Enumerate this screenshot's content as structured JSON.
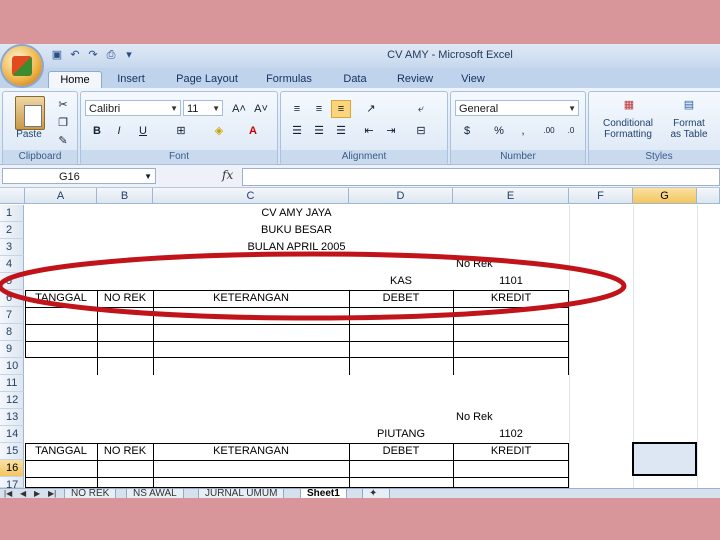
{
  "window": {
    "title": "CV AMY - Microsoft Excel"
  },
  "ribbon": {
    "tabs": [
      "Home",
      "Insert",
      "Page Layout",
      "Formulas",
      "Data",
      "Review",
      "View"
    ],
    "groups": [
      "Clipboard",
      "Font",
      "Alignment",
      "Number",
      "Styles"
    ],
    "paste_label": "Paste",
    "font_name": "Calibri",
    "font_size": "11",
    "number_format": "General",
    "conditional_formatting": [
      "Conditional",
      "Formatting"
    ],
    "format_as_table": [
      "Format",
      "as Table"
    ]
  },
  "formula_bar": {
    "name_box": "G16",
    "fx": "fx",
    "value": ""
  },
  "columns": [
    "A",
    "B",
    "C",
    "D",
    "E",
    "F",
    "G"
  ],
  "selected_column": "G",
  "rows": [
    "1",
    "2",
    "3",
    "4",
    "5",
    "6",
    "7",
    "8",
    "9",
    "10",
    "11",
    "12",
    "13",
    "14",
    "15",
    "16",
    "17"
  ],
  "selected_row": "16",
  "cells": {
    "C1": "CV AMY JAYA",
    "C2": "BUKU BESAR",
    "C3": "BULAN APRIL 2005",
    "E4": "No Rek",
    "D5": "KAS",
    "E5": "1101",
    "A6": "TANGGAL",
    "B6": "NO REK",
    "C6": "KETERANGAN",
    "D6": "DEBET",
    "E6": "KREDIT",
    "E13": "No Rek",
    "D14": "PIUTANG",
    "E14": "1102",
    "A15": "TANGGAL",
    "B15": "NO REK",
    "C15": "KETERANGAN",
    "D15": "DEBET",
    "E15": "KREDIT"
  },
  "sheet_tabs": [
    "NO REK",
    "NS AWAL",
    "JURNAL UMUM",
    "Sheet1"
  ],
  "active_sheet": "Sheet1",
  "annotation": {
    "color": "#c0141a"
  }
}
